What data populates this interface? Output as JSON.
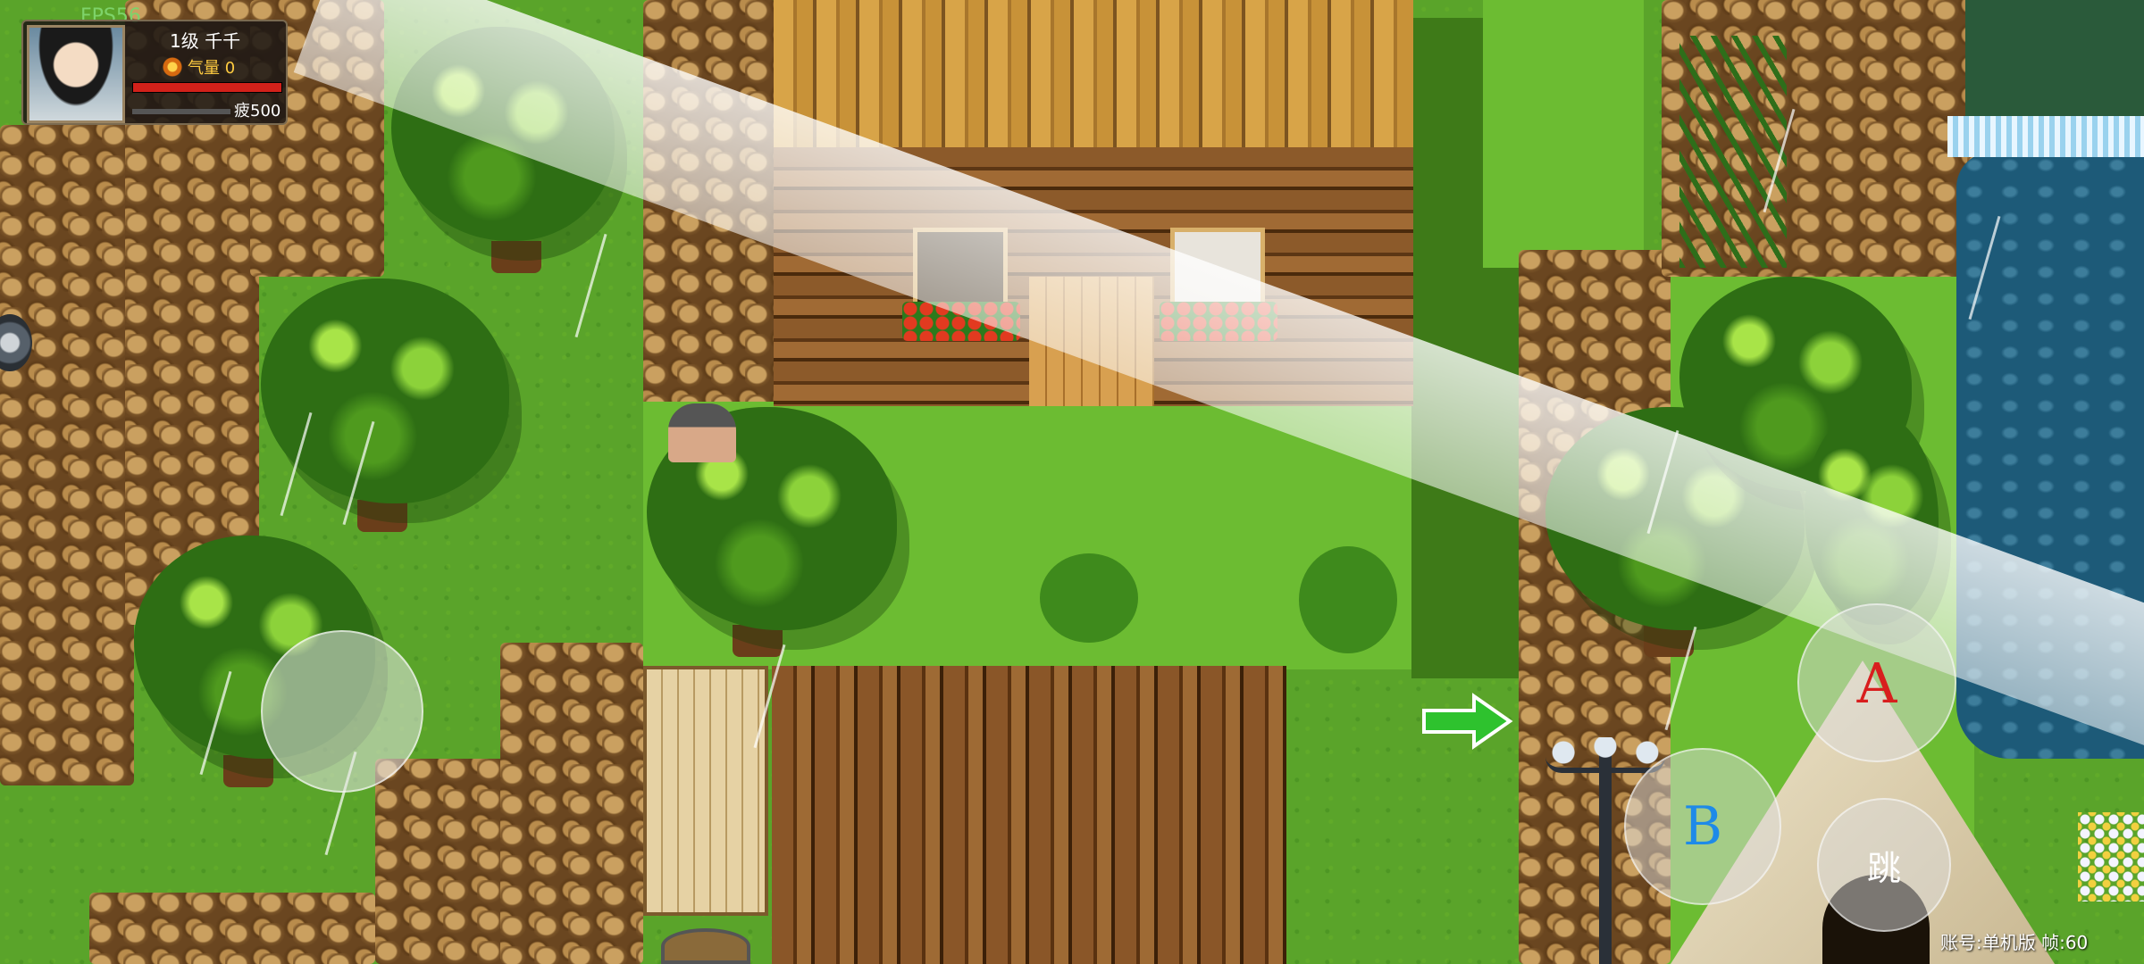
{
  "hud": {
    "fps": "FPS56",
    "level_name": "1级 千千",
    "qi": "气量 0",
    "fatigue": "疲500",
    "hp_fraction": 1.0
  },
  "controls": {
    "a_label": "A",
    "b_label": "B",
    "jump_label": "跳"
  },
  "footer": {
    "account": "账号:单机版 帧:60"
  },
  "colors": {
    "hp": "#d2211a",
    "qi": "#ffcc40",
    "fps": "#7ed36a",
    "a_button": "#d81e1e",
    "b_button": "#1e8ae8",
    "arrow": "#2ec22e"
  },
  "icons": [
    "qi-icon",
    "side-knob-icon",
    "right-arrow-icon",
    "lamp-post-icon"
  ]
}
